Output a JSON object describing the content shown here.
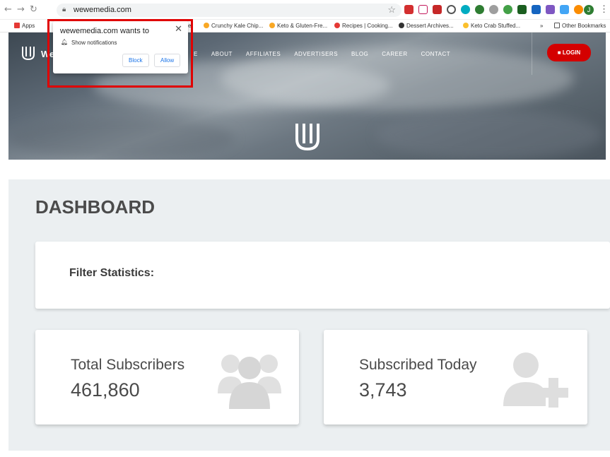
{
  "browser": {
    "url": "wewemedia.com",
    "profile_letter": "J",
    "bookmarks": [
      {
        "label": "Apps",
        "color": "#e53935"
      },
      {
        "label": "Crunchy Kale Chip...",
        "color": "#f9a825"
      },
      {
        "label": "Keto & Gluten-Fre...",
        "color": "#f9a825"
      },
      {
        "label": "Recipes | Cooking...",
        "color": "#e53935"
      },
      {
        "label": "Dessert Archives...",
        "color": "#333333"
      },
      {
        "label": "Keto Crab Stuffed...",
        "color": "#fbc02d"
      },
      {
        "label": "»",
        "color": ""
      },
      {
        "label": "Other Bookmarks",
        "color": "#555555"
      }
    ],
    "partial_bookmark": "er"
  },
  "site": {
    "logo_partial": "We",
    "menu": [
      "E",
      "ABOUT",
      "AFFILIATES",
      "ADVERTISERS",
      "BLOG",
      "CAREER",
      "CONTACT"
    ],
    "login_label": "LOGIN",
    "accent": "#d40000"
  },
  "popup": {
    "title": "wewemedia.com wants to",
    "message": "Show notifications",
    "block_label": "Block",
    "allow_label": "Allow"
  },
  "dashboard": {
    "title": "DASHBOARD",
    "filter_label": "Filter Statistics:",
    "stats": [
      {
        "label": "Total Subscribers",
        "value": "461,860",
        "icon": "users-group-icon"
      },
      {
        "label": "Subscribed Today",
        "value": "3,743",
        "icon": "user-add-icon"
      }
    ]
  }
}
